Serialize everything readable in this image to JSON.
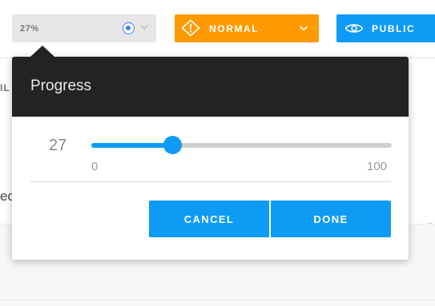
{
  "toolbar": {
    "progress_value": "27%",
    "status_label": "NORMAL",
    "visibility_label": "PUBLIC"
  },
  "background": {
    "frag_il": "IL",
    "frag_ec": "ec",
    "frag_5": "5"
  },
  "popover": {
    "title": "Progress",
    "value": "27",
    "value_fraction": 0.27,
    "min_label": "0",
    "max_label": "100",
    "cancel_label": "CANCEL",
    "done_label": "DONE"
  },
  "icons": {
    "progress": "radio-dot-icon",
    "status": "warning-icon",
    "dropdown": "chevron-down-icon",
    "visibility": "eye-icon"
  },
  "colors": {
    "accent_blue": "#0d9bf6",
    "status_orange": "#ff9a00",
    "header_dark": "#232323",
    "track_gray": "#cfcfcf"
  }
}
